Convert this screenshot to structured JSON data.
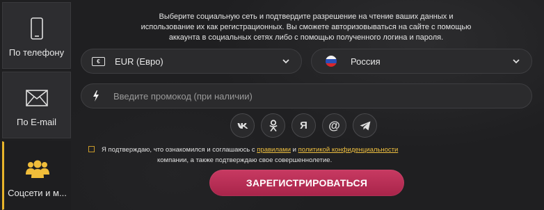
{
  "tabs": [
    {
      "label": "По телефону",
      "icon": "phone-icon"
    },
    {
      "label": "По E-mail",
      "icon": "envelope-icon"
    },
    {
      "label": "Соцсети и м...",
      "icon": "users-icon",
      "active": true
    }
  ],
  "info": {
    "line1": "Выберите социальную сеть и подтвердите разрешение на чтение ваших данных и",
    "line2": "использование их как регистрационных.  Вы сможете авторизовываться на сайте с помощью",
    "line3": "аккаунта в социальных сетях либо с помощью полученного логина и пароля."
  },
  "currency": {
    "value": "EUR (Евро)",
    "icon": "currency-icon"
  },
  "country": {
    "value": "Россия",
    "icon": "russia-flag-icon"
  },
  "promo": {
    "placeholder": "Введите промокод (при наличии)",
    "icon": "lightning-icon"
  },
  "socials": [
    {
      "name": "vk",
      "label": "vk"
    },
    {
      "name": "odnoklassniki",
      "label": "ok"
    },
    {
      "name": "yandex",
      "label": "Я"
    },
    {
      "name": "mail",
      "label": "@"
    },
    {
      "name": "telegram",
      "label": ""
    }
  ],
  "agreement": {
    "text_before": "Я подтверждаю, что ознакомился и соглашаюсь с ",
    "link_rules": "правилами",
    "text_and": " и ",
    "link_privacy": "политикой конфиденциальности",
    "line2": "компании, а также подтверждаю свое совершеннолетие."
  },
  "register_button": "ЗАРЕГИСТРИРОВАТЬСЯ",
  "colors": {
    "accent": "#e8b52b",
    "button": "#b82d55",
    "link": "#f0c040",
    "background": "#1f1f21"
  }
}
